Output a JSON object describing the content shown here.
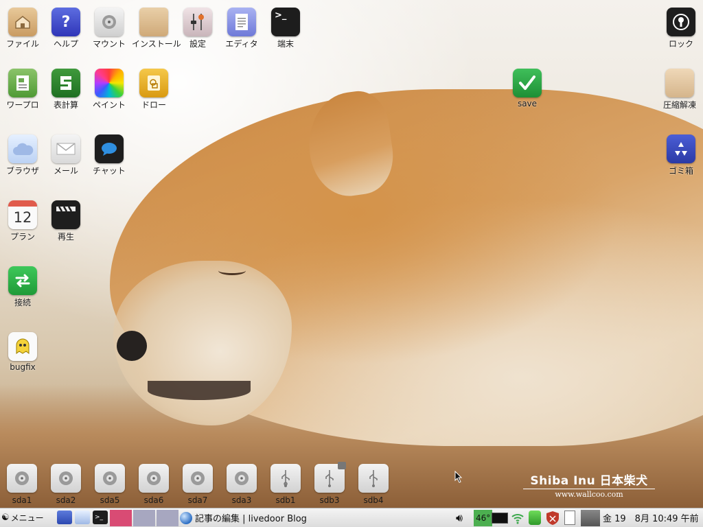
{
  "desktop": {
    "icons": [
      {
        "label": "ファイル",
        "icon": "folder-home-icon"
      },
      {
        "label": "ヘルプ",
        "icon": "help-icon"
      },
      {
        "label": "マウント",
        "icon": "drive-icon"
      },
      {
        "label": "インストール",
        "icon": "package-icon"
      },
      {
        "label": "設定",
        "icon": "settings-icon"
      },
      {
        "label": "エディタ",
        "icon": "text-editor-icon"
      },
      {
        "label": "端末",
        "icon": "terminal-icon"
      },
      {
        "label": "ロック",
        "icon": "lock-icon"
      },
      {
        "label": "ワープロ",
        "icon": "word-processor-icon"
      },
      {
        "label": "表計算",
        "icon": "spreadsheet-icon"
      },
      {
        "label": "ペイント",
        "icon": "paint-icon"
      },
      {
        "label": "ドロー",
        "icon": "draw-icon"
      },
      {
        "label": "save",
        "icon": "checkmark-icon"
      },
      {
        "label": "圧縮解凍",
        "icon": "archive-icon"
      },
      {
        "label": "ブラウザ",
        "icon": "cloud-browser-icon"
      },
      {
        "label": "メール",
        "icon": "mail-icon"
      },
      {
        "label": "チャット",
        "icon": "chat-icon"
      },
      {
        "label": "ゴミ箱",
        "icon": "recycle-bin-icon"
      },
      {
        "label": "プラン",
        "icon": "calendar-icon",
        "glyph": "12"
      },
      {
        "label": "再生",
        "icon": "video-player-icon"
      },
      {
        "label": "接続",
        "icon": "network-connect-icon"
      },
      {
        "label": "bugfix",
        "icon": "ghost-icon"
      }
    ],
    "drives": [
      "sda1",
      "sda2",
      "sda5",
      "sda6",
      "sda7",
      "sda3",
      "sdb1",
      "sdb3",
      "sdb4"
    ]
  },
  "wallpaper": {
    "logo_line1": "Shiba Inu 日本柴犬",
    "logo_line2": "www.wallcoo.com"
  },
  "taskbar": {
    "menu_label": "メニュー",
    "task_window_title": "記事の編集 | livedoor Blog",
    "temperature": "46°",
    "clock": "金 19　8月 10:49 午前"
  },
  "colors": {
    "accent_red": "#d94b74",
    "desk_gray": "#a7a7c0",
    "temp_green": "#4caf50"
  }
}
